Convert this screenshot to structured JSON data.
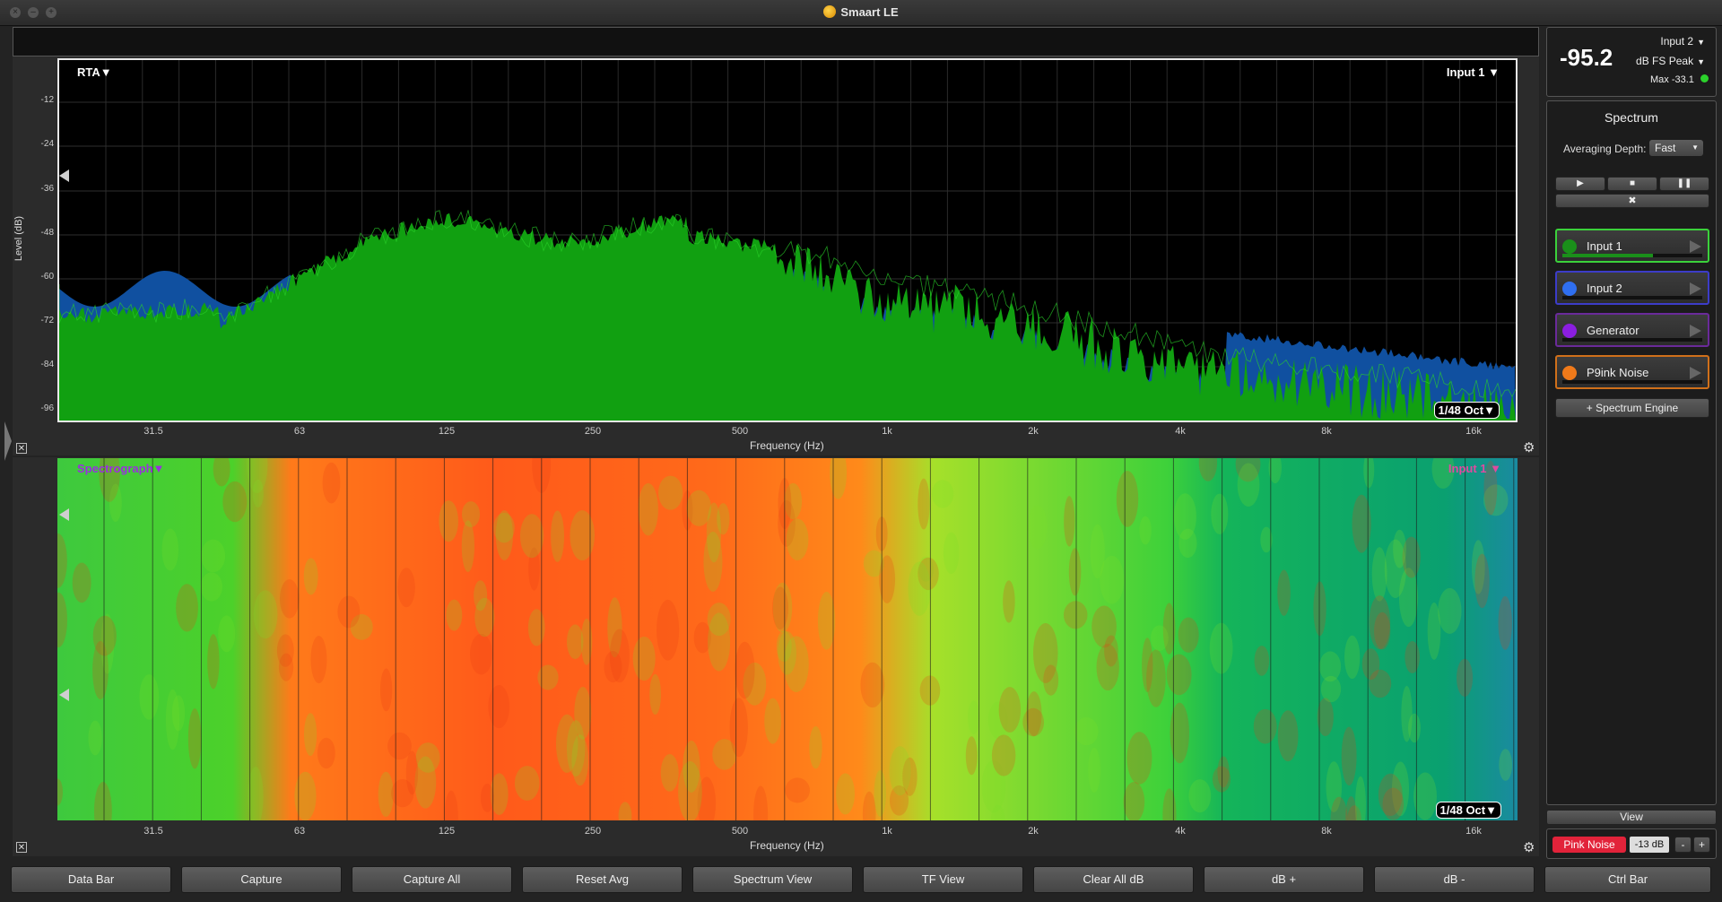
{
  "window": {
    "title": "Smaart LE"
  },
  "rta": {
    "mode": "RTA",
    "input": "Input 1",
    "resolution": "1/48 Oct",
    "y_label": "Level (dB)",
    "y_ticks": [
      "-12",
      "-24",
      "-36",
      "-48",
      "-60",
      "-72",
      "-84",
      "-96"
    ],
    "x_label": "Frequency (Hz)",
    "x_ticks": [
      "31.5",
      "63",
      "125",
      "250",
      "500",
      "1k",
      "2k",
      "4k",
      "8k",
      "16k"
    ]
  },
  "spectrograph": {
    "mode": "Spectrograph",
    "input": "Input 1",
    "resolution": "1/48 Oct",
    "x_label": "Frequency (Hz)",
    "x_ticks": [
      "31.5",
      "63",
      "125",
      "250",
      "500",
      "1k",
      "2k",
      "4k",
      "8k",
      "16k"
    ]
  },
  "meter": {
    "value": "-95.2",
    "input": "Input 2",
    "unit": "dB FS Peak",
    "max": "Max -33.1",
    "status_color": "#2bd12b"
  },
  "spectrum_panel": {
    "title": "Spectrum",
    "averaging_label": "Averaging Depth:",
    "averaging_value": "Fast",
    "play_icon": "play-icon",
    "stop_icon": "stop-icon",
    "pause_icon": "pause-icon",
    "tools_icon": "tools-icon",
    "inputs": [
      {
        "name": "Input 1",
        "color": "#1a8f1a",
        "border": "#3bd13b",
        "level": 0.65
      },
      {
        "name": "Input 2",
        "color": "#2f6ff0",
        "border": "#3c3cc8",
        "level": 0.0
      },
      {
        "name": "Generator",
        "color": "#8b1ee0",
        "border": "#6a2a9a",
        "level": 0.0
      },
      {
        "name": "P9ink Noise",
        "color": "#f07a1a",
        "border": "#d0701a",
        "level": 0.0
      }
    ],
    "add_engine": "+ Spectrum Engine"
  },
  "side_footer": {
    "view_label": "View",
    "pink_noise": "Pink Noise",
    "noise_level": "-13 dB",
    "minus": "-",
    "plus": "+",
    "pink_color": "#e2233a"
  },
  "bottom_buttons": [
    "Data Bar",
    "Capture",
    "Capture All",
    "Reset Avg",
    "Spectrum View",
    "TF View",
    "Clear All dB",
    "dB +",
    "dB -",
    "Ctrl Bar"
  ],
  "colors": {
    "trace_green": "#11a011",
    "trace_blue": "#1050a0"
  }
}
